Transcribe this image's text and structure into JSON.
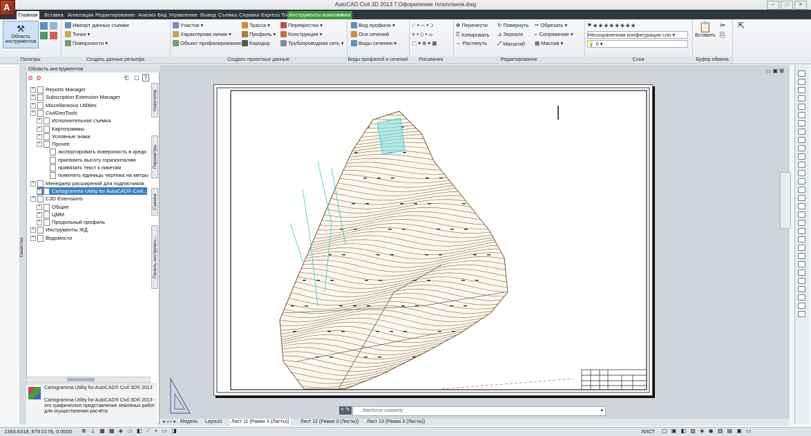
{
  "app": {
    "title": "AutoCAD Civil 3D 2013   7.Оформление топопланов.dwg"
  },
  "colors": {
    "accent": "#3c7fc2",
    "tabbar": "#2e3640",
    "context_tab": "#3f9a3b",
    "contour": "#8a6a3a",
    "cyan_lines": "#2ec8c8"
  },
  "ribbon_tabs": [
    "Главная",
    "Вставка",
    "Аннотации",
    "Редактирование",
    "Анализ",
    "Вид",
    "Управление",
    "Вывод",
    "Съемка",
    "Справка",
    "Express Tools",
    "Инструменты компоновки"
  ],
  "ribbon": {
    "toolspace_label": "Область инструментов",
    "panels": {
      "palettes": "Палитры",
      "create_ground": "Создать данные рельефа",
      "create_design": "Создать проектные данные",
      "profile_views": "Виды профилей и сечений",
      "draw": "Рисование",
      "modify": "Редактирование",
      "layers": "Слои",
      "clipboard": "Буфер обмена"
    },
    "items": {
      "import_survey": "Импорт данных съемки",
      "points": "Точки",
      "surfaces": "Поверхности",
      "parcel": "Участок",
      "feature_line": "Характерная линия",
      "grading": "Объект профилирования",
      "alignment": "Трасса",
      "profile": "Профиль",
      "corridor": "Коридор",
      "intersections": "Перекрестки",
      "assembly": "Конструкция",
      "pipe_network": "Трубопроводная сеть",
      "profile_view": "Вид профиля",
      "sample_lines": "Оси сечений",
      "section_views": "Виды сечения",
      "move": "Перенести",
      "rotate": "Повернуть",
      "trim": "Обрезать",
      "copy": "Копировать",
      "mirror": "Зеркало",
      "fillet": "Сопряжение",
      "stretch": "Растянуть",
      "scale": "Масштаб",
      "array": "Массив",
      "layer_state": "Несохраненная конфигурация сло",
      "layer_current": "0",
      "paste": "Вставить"
    }
  },
  "palette": {
    "title": "Область инструментов",
    "tree": [
      {
        "label": "Reports Manager",
        "indent": 0,
        "sel": false
      },
      {
        "label": "Subscription Extension Manager",
        "indent": 0,
        "sel": false
      },
      {
        "label": "Miscellaneous Utilities",
        "indent": 0,
        "sel": false
      },
      {
        "label": "CivilGeoTools",
        "indent": 0,
        "sel": false
      },
      {
        "label": "Исполнительная съемка",
        "indent": 1,
        "sel": false
      },
      {
        "label": "Картограммы",
        "indent": 1,
        "sel": false
      },
      {
        "label": "Условные знаки",
        "indent": 1,
        "sel": false
      },
      {
        "label": "Прочее",
        "indent": 1,
        "sel": false
      },
      {
        "label": "экспортировать поверхность в кредо",
        "indent": 2,
        "sel": false
      },
      {
        "label": "присвоить высоту горизонталям",
        "indent": 2,
        "sel": false
      },
      {
        "label": "привязать текст к пикетам",
        "indent": 2,
        "sel": false
      },
      {
        "label": "поменять единицы чертежа на метры",
        "indent": 2,
        "sel": false
      },
      {
        "label": "Менеджер расширений для подписчиков",
        "indent": 0,
        "sel": false
      },
      {
        "label": "Cartogramma Utility for AutoCAD® Civil...",
        "indent": 1,
        "sel": true
      },
      {
        "label": "C3D Extensions",
        "indent": 0,
        "sel": false
      },
      {
        "label": "Общие",
        "indent": 1,
        "sel": false
      },
      {
        "label": "ЦММ",
        "indent": 1,
        "sel": false
      },
      {
        "label": "Продольный профиль",
        "indent": 1,
        "sel": false
      },
      {
        "label": "Инструменты ЖД",
        "indent": 0,
        "sel": false
      },
      {
        "label": "Ведомости",
        "indent": 0,
        "sel": false
      }
    ],
    "vtabs": [
      "Навигатор",
      "Параметры",
      "Съемка",
      "Панель инструмен..."
    ],
    "side_label": "Свойства",
    "desc_title": "Cartogramma Utility for AutoCAD® Civil 3D® 2013",
    "desc_text": "Cartogramma Utility for AutoCAD® Civil 3D® 2013 - это графическое представление земляных работ для осуществления расчёта"
  },
  "command_line": {
    "placeholder": "Введите команду"
  },
  "layout_tabs": [
    "Модель",
    "Layout1",
    "Лист 11 (Рамки 3 (Листы))",
    "Лист 12 (Рамки 3 (Листы))",
    "Лист 13 (Рамки 3 (Листы))"
  ],
  "status": {
    "coords": "1363.6318, 879.0176, 0.0000",
    "space": "ЛИСТ"
  }
}
